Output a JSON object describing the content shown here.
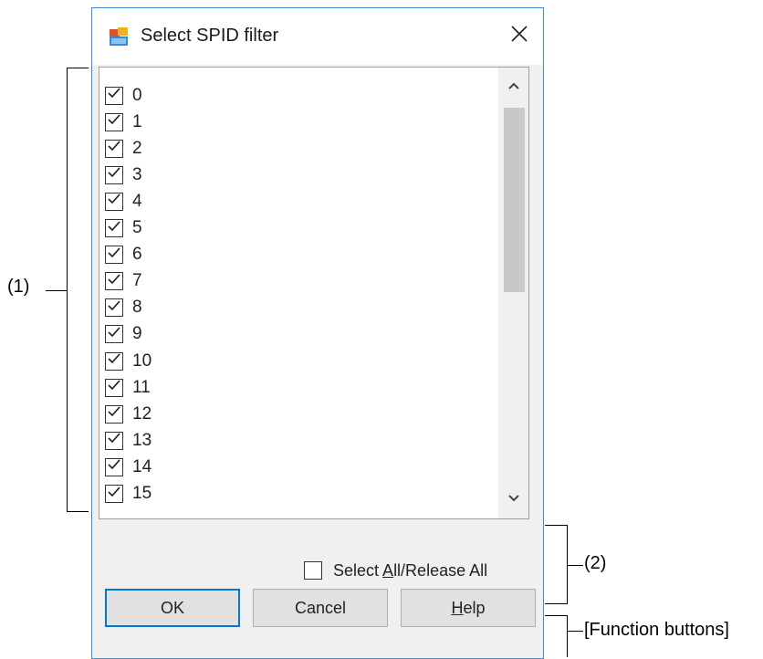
{
  "dialog": {
    "title": "Select SPID filter",
    "close_label": "✕"
  },
  "list": {
    "items": [
      {
        "label": "0",
        "checked": true
      },
      {
        "label": "1",
        "checked": true
      },
      {
        "label": "2",
        "checked": true
      },
      {
        "label": "3",
        "checked": true
      },
      {
        "label": "4",
        "checked": true
      },
      {
        "label": "5",
        "checked": true
      },
      {
        "label": "6",
        "checked": true
      },
      {
        "label": "7",
        "checked": true
      },
      {
        "label": "8",
        "checked": true
      },
      {
        "label": "9",
        "checked": true
      },
      {
        "label": "10",
        "checked": true
      },
      {
        "label": "11",
        "checked": true
      },
      {
        "label": "12",
        "checked": true
      },
      {
        "label": "13",
        "checked": true
      },
      {
        "label": "14",
        "checked": true
      },
      {
        "label": "15",
        "checked": true
      }
    ]
  },
  "select_all": {
    "label_pre": "Select ",
    "label_mnemonic": "A",
    "label_post": "ll/Release All",
    "checked": false
  },
  "buttons": {
    "ok": "OK",
    "cancel": "Cancel",
    "help_mnemonic": "H",
    "help_rest": "elp"
  },
  "annotations": {
    "list_area": "(1)",
    "select_all_area": "(2)",
    "function_buttons": "[Function buttons]"
  },
  "colors": {
    "dialog_border": "#3c8ad6",
    "default_button_border": "#0078d7",
    "check_mark": "#1f1f1f"
  }
}
